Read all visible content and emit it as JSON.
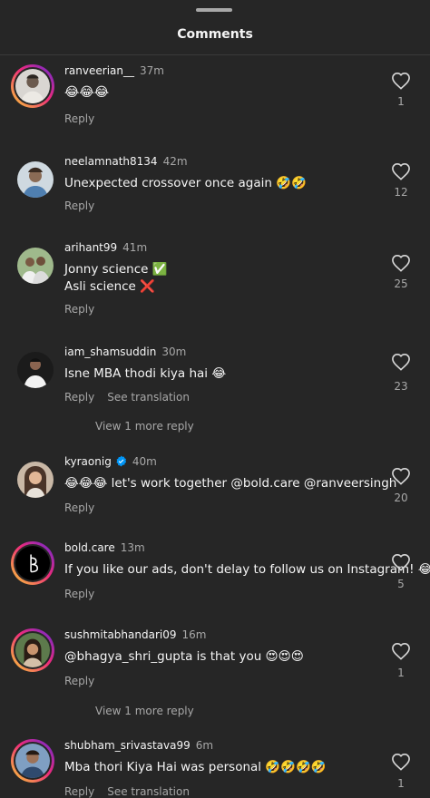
{
  "header": {
    "title": "Comments"
  },
  "comments": [
    {
      "username": "ranveerian__",
      "time": "37m",
      "text": [
        "😂😂😂"
      ],
      "reply": "Reply",
      "likes": "1"
    },
    {
      "username": "neelamnath8134",
      "time": "42m",
      "text": [
        "Unexpected crossover once again 🤣🤣"
      ],
      "reply": "Reply",
      "likes": "12"
    },
    {
      "username": "arihant99",
      "time": "41m",
      "text": [
        "Jonny science ✅",
        "Asli science ❌"
      ],
      "reply": "Reply",
      "likes": "25"
    },
    {
      "username": "iam_shamsuddin",
      "time": "30m",
      "text": [
        "Isne MBA thodi kiya hai 😂"
      ],
      "reply": "Reply",
      "see_translation": "See translation",
      "view_more": "View 1 more reply",
      "likes": "23"
    },
    {
      "username": "kyraonig",
      "time": "40m",
      "verified": true,
      "text": [
        "😂😂😂 let's work together @bold.care @ranveersingh"
      ],
      "reply": "Reply",
      "likes": "20"
    },
    {
      "username": "bold.care",
      "time": "13m",
      "text": [
        "If you like our ads, don't delay to follow us on Instagram! 😂"
      ],
      "reply": "Reply",
      "likes": "5"
    },
    {
      "username": "sushmitabhandari09",
      "time": "16m",
      "text": [
        "@bhagya_shri_gupta is that you 😍😍😍"
      ],
      "reply": "Reply",
      "view_more": "View 1 more reply",
      "likes": "1"
    },
    {
      "username": "shubham_srivastava99",
      "time": "6m",
      "text": [
        "Mba thori Kiya Hai was personal 🤣🤣🤣🤣"
      ],
      "reply": "Reply",
      "see_translation": "See translation",
      "likes": "1"
    }
  ],
  "colors": {
    "background": "#262626",
    "text": "#f5f5f5",
    "muted": "#a8a8a8",
    "verified": "#0095f6"
  },
  "icons": {
    "like": "heart-outline-icon",
    "verified": "verified-badge-icon"
  }
}
